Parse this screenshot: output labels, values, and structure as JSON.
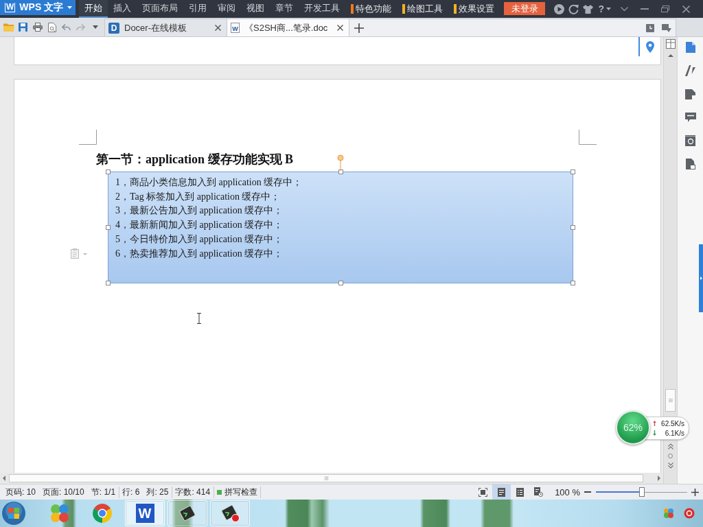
{
  "title_bar": {
    "logo_mark": "W",
    "app_menu": "WPS 文字",
    "menu_tabs": [
      {
        "label": "开始",
        "selected": true
      },
      {
        "label": "插入",
        "selected": false
      },
      {
        "label": "页面布局",
        "selected": false
      },
      {
        "label": "引用",
        "selected": false
      },
      {
        "label": "审阅",
        "selected": false
      },
      {
        "label": "视图",
        "selected": false
      },
      {
        "label": "章节",
        "selected": false
      },
      {
        "label": "开发工具",
        "selected": false
      }
    ],
    "context_tabs": [
      {
        "label": "特色功能",
        "color": "#f07a1e"
      },
      {
        "label": "绘图工具",
        "color": "#f0b323"
      },
      {
        "label": "效果设置",
        "color": "#f0b323"
      }
    ],
    "login_button": "未登录",
    "help_button": "?"
  },
  "tab_bar": {
    "documents": [
      {
        "kind": "docer",
        "icon_letter": "D",
        "label": "Docer-在线模板",
        "selected": false
      },
      {
        "kind": "writer",
        "icon_letter": "W",
        "label": "《S2SH商...笔录.doc",
        "selected": true
      }
    ]
  },
  "document": {
    "heading": "第一节：application 缓存功能实现 B",
    "text_box": {
      "selected": true,
      "lines": [
        "1，商品小类信息加入到 application 缓存中；",
        "2，Tag 标签加入到 application 缓存中；",
        "3，最新公告加入到 application 缓存中；",
        "4，最新新闻加入到 application 缓存中；",
        "5，今日特价加入到 application 缓存中；",
        "6，热卖推荐加入到 application 缓存中；"
      ]
    }
  },
  "side_panel": {
    "tools": [
      {
        "kind": "document",
        "selected": true
      },
      {
        "kind": "style",
        "selected": false
      },
      {
        "kind": "shape",
        "selected": false
      },
      {
        "kind": "comment",
        "selected": false
      },
      {
        "kind": "backup",
        "selected": false
      },
      {
        "kind": "protect",
        "selected": false
      }
    ]
  },
  "status_bar": {
    "groups": [
      [
        "页码: 10",
        "页面: 10/10",
        "节: 1/1"
      ],
      [
        "行: 6",
        "列: 25"
      ],
      [
        "字数: 414"
      ]
    ],
    "spell_check": "拼写检查",
    "view_buttons": [
      {
        "kind": "fullscreen",
        "selected": false
      },
      {
        "kind": "page",
        "selected": true
      },
      {
        "kind": "outline",
        "selected": false
      },
      {
        "kind": "web",
        "selected": false
      }
    ],
    "zoom": "100 %",
    "zoom_slider": {
      "level": 0.5
    }
  },
  "net_monitor": {
    "usage": "62%",
    "upload": "62.5K/s",
    "download": "6.1K/s"
  },
  "taskbar": {
    "apps": [
      {
        "kind": "tiles",
        "running": false,
        "selected": false
      },
      {
        "kind": "browser",
        "running": false,
        "selected": false
      },
      {
        "kind": "writer",
        "icon_letter": "W",
        "running": true,
        "selected": true
      },
      {
        "kind": "terminal",
        "running": true,
        "selected": false
      },
      {
        "kind": "terminal-rec",
        "running": true,
        "selected": false
      }
    ]
  }
}
